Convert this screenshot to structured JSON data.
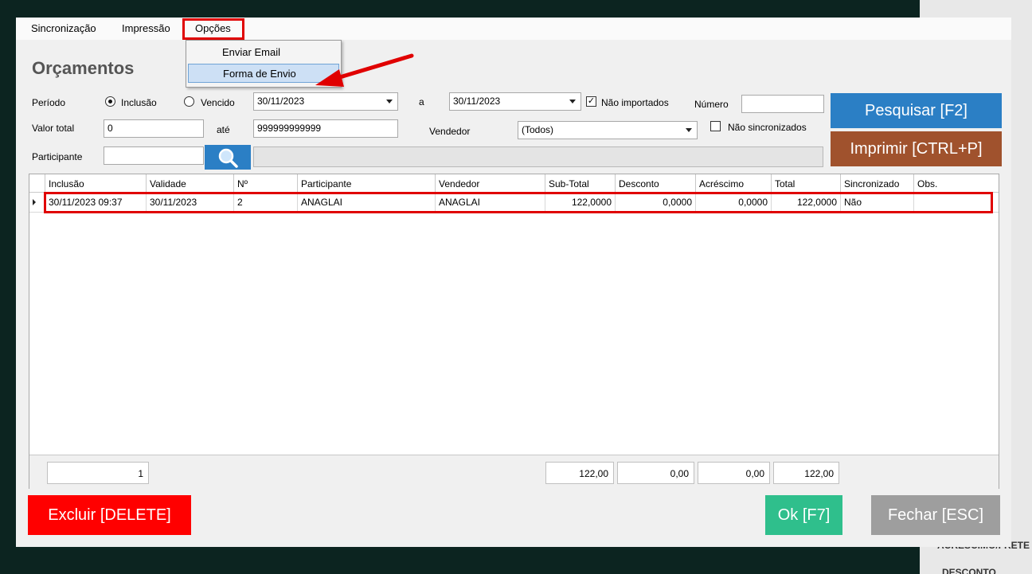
{
  "menu": {
    "items": [
      "Sincronização",
      "Impressão",
      "Opções"
    ],
    "dropdown": [
      "Enviar Email",
      "Forma de Envio"
    ]
  },
  "page": {
    "title": "Orçamentos"
  },
  "filters": {
    "periodo_label": "Período",
    "radio_inclusao": "Inclusão",
    "radio_vencido": "Vencido",
    "date_from": "30/11/2023",
    "a_label": "a",
    "date_to": "30/11/2023",
    "nao_importados": "Não importados",
    "numero_label": "Número",
    "numero_value": "",
    "valor_total_label": "Valor total",
    "valor_from": "0",
    "ate_label": "até",
    "valor_to": "999999999999",
    "vendedor_label": "Vendedor",
    "vendedor_value": "(Todos)",
    "nao_sincronizados": "Não sincronizados",
    "participante_label": "Participante",
    "participante_value": ""
  },
  "buttons": {
    "pesquisar": "Pesquisar [F2]",
    "imprimir": "Imprimir [CTRL+P]",
    "excluir": "Excluir [DELETE]",
    "ok": "Ok [F7]",
    "fechar": "Fechar [ESC]"
  },
  "grid": {
    "columns": [
      "Inclusão",
      "Validade",
      "Nº",
      "Participante",
      "Vendedor",
      "Sub-Total",
      "Desconto",
      "Acréscimo",
      "Total",
      "Sincronizado",
      "Obs."
    ],
    "rows": [
      [
        "30/11/2023 09:37",
        "30/11/2023",
        "2",
        "ANAGLAI",
        "ANAGLAI",
        "122,0000",
        "0,0000",
        "0,0000",
        "122,0000",
        "Não",
        ""
      ]
    ],
    "footer": {
      "count": "1",
      "subtotal": "122,00",
      "desconto": "0,00",
      "acrescimo": "0,00",
      "total": "122,00"
    }
  },
  "background_text": [
    "ACRESCIMO/FRETE",
    "DESCONTO"
  ],
  "colors": {
    "pesquisar": "#2b7fc5",
    "imprimir": "#a0522d",
    "excluir": "#ff0000",
    "ok": "#2fbf8c",
    "fechar": "#9e9e9e",
    "highlight": "#e00000"
  }
}
